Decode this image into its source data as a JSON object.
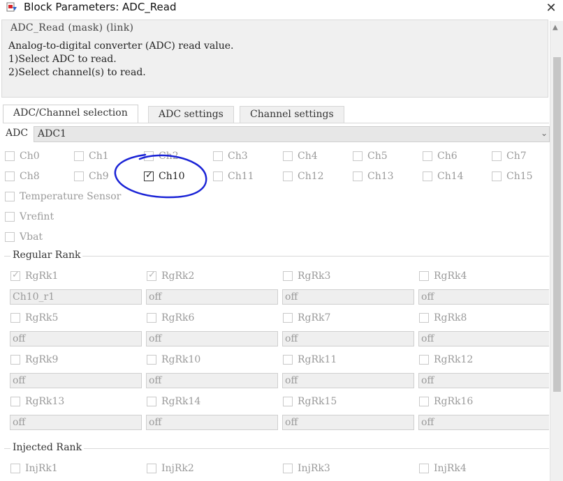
{
  "window": {
    "title": "Block Parameters: ADC_Read",
    "close_glyph": "✕"
  },
  "description": {
    "header": "ADC_Read (mask) (link)",
    "lines": [
      "Analog-to-digital converter (ADC) read value.",
      "1)Select ADC to read.",
      "2)Select channel(s) to read."
    ]
  },
  "tabs": [
    "ADC/Channel selection",
    "ADC settings",
    "Channel settings"
  ],
  "adc": {
    "label": "ADC",
    "value": "ADC1"
  },
  "channels": {
    "row1": [
      "Ch0",
      "Ch1",
      "Ch2",
      "Ch3",
      "Ch4",
      "Ch5",
      "Ch6",
      "Ch7"
    ],
    "row2": [
      "Ch8",
      "Ch9",
      "Ch10",
      "Ch11",
      "Ch12",
      "Ch13",
      "Ch14",
      "Ch15"
    ],
    "ch10_checked": true,
    "extras": [
      "Temperature Sensor",
      "Vrefint",
      "Vbat"
    ]
  },
  "regular_rank": {
    "title": "Regular Rank",
    "items": [
      {
        "label": "RgRk1",
        "checked": true,
        "value": "Ch10_r1"
      },
      {
        "label": "RgRk2",
        "checked": true,
        "value": "off"
      },
      {
        "label": "RgRk3",
        "checked": false,
        "value": "off"
      },
      {
        "label": "RgRk4",
        "checked": false,
        "value": "off"
      },
      {
        "label": "RgRk5",
        "checked": false,
        "value": "off"
      },
      {
        "label": "RgRk6",
        "checked": false,
        "value": "off"
      },
      {
        "label": "RgRk7",
        "checked": false,
        "value": "off"
      },
      {
        "label": "RgRk8",
        "checked": false,
        "value": "off"
      },
      {
        "label": "RgRk9",
        "checked": false,
        "value": "off"
      },
      {
        "label": "RgRk10",
        "checked": false,
        "value": "off"
      },
      {
        "label": "RgRk11",
        "checked": false,
        "value": "off"
      },
      {
        "label": "RgRk12",
        "checked": false,
        "value": "off"
      },
      {
        "label": "RgRk13",
        "checked": false,
        "value": "off"
      },
      {
        "label": "RgRk14",
        "checked": false,
        "value": "off"
      },
      {
        "label": "RgRk15",
        "checked": false,
        "value": "off"
      },
      {
        "label": "RgRk16",
        "checked": false,
        "value": "off"
      }
    ]
  },
  "injected_rank": {
    "title": "Injected Rank",
    "items": [
      "InjRk1",
      "InjRk2",
      "InjRk3",
      "InjRk4"
    ]
  },
  "colors": {
    "annotation": "#1a23d6",
    "disabled_text": "#9a9a9a",
    "panel_bg": "#f0f0f0"
  },
  "icons": {
    "title_icon": "simulink-block-icon",
    "close": "close-icon",
    "check": "check-icon"
  }
}
